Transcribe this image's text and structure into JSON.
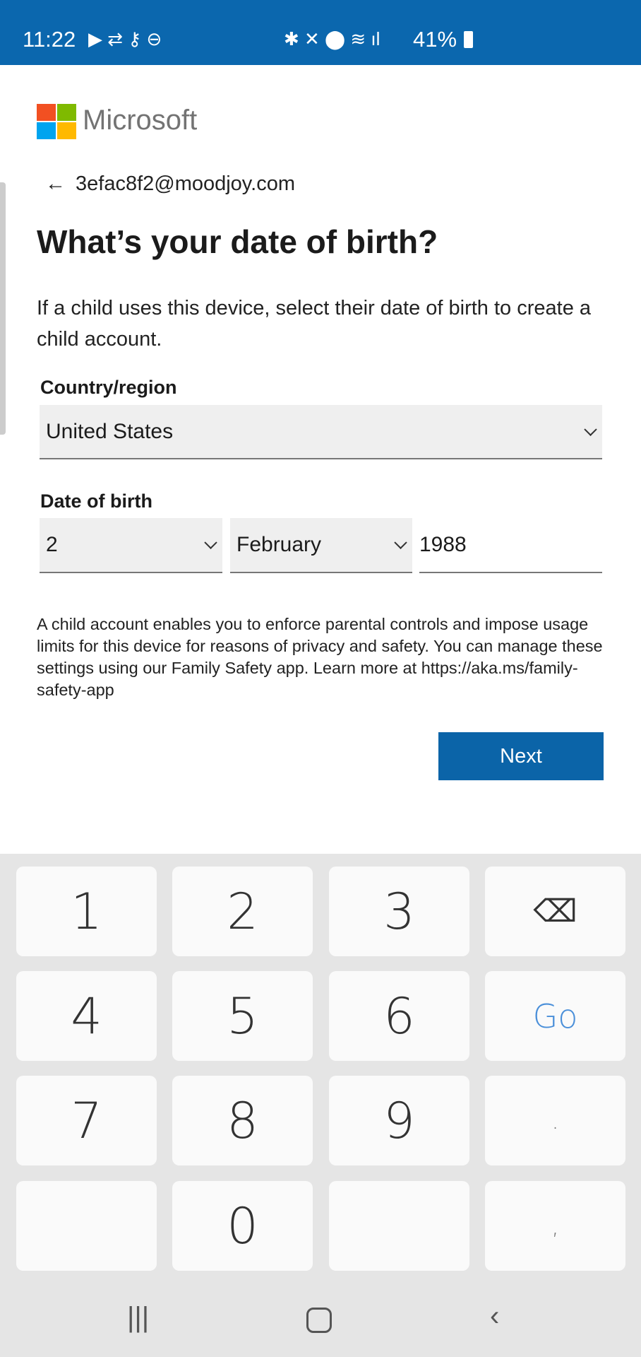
{
  "status_bar": {
    "time": "11:22",
    "battery": "41%",
    "left_icons": [
      "video-icon",
      "sync-icon",
      "key-icon",
      "dnd-icon"
    ],
    "right_icons": [
      "bluetooth-icon",
      "mute-icon",
      "location-icon",
      "wifi-icon",
      "signal-icon",
      "battery-icon"
    ]
  },
  "brand": {
    "name": "Microsoft",
    "colors": [
      "#f25022",
      "#7fba00",
      "#00a4ef",
      "#ffb900"
    ]
  },
  "account": {
    "email": "3efac8f2@moodjoy.com"
  },
  "page": {
    "title": "What’s your date of birth?",
    "description": "If a child uses this device, select their date of birth to create a child account."
  },
  "country": {
    "label": "Country/region",
    "value": "United States"
  },
  "dob": {
    "label": "Date of birth",
    "day": "2",
    "month": "February",
    "year": "1988"
  },
  "info": "A child account enables you to enforce parental controls and impose usage limits for this device for reasons of privacy and safety. You can manage these settings using our Family Safety app. Learn more at https://aka.ms/family-safety-app",
  "next_label": "Next",
  "keyboard": {
    "keys": [
      "1",
      "2",
      "3",
      "⌫",
      "4",
      "5",
      "6",
      "Go",
      "7",
      "8",
      "9",
      ".",
      "",
      "0",
      "",
      ","
    ]
  },
  "accent": "#0b67ae"
}
